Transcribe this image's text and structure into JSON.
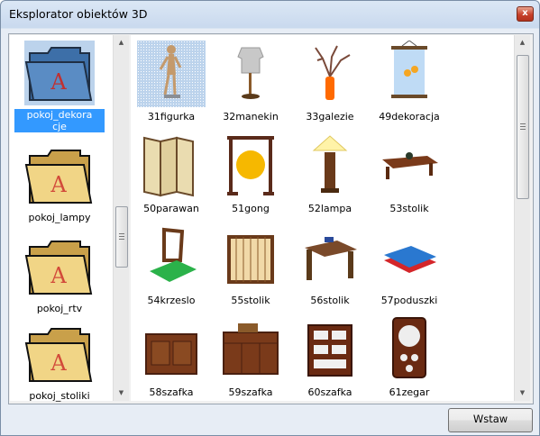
{
  "window": {
    "title": "Eksplorator obiektów 3D",
    "close_symbol": "x"
  },
  "folders": [
    {
      "label": "pokoj_dekoracje",
      "line1": "pokoj_dekora",
      "line2": "cje",
      "selected": true
    },
    {
      "label": "pokoj_lampy"
    },
    {
      "label": "pokoj_rtv"
    },
    {
      "label": "pokoj_stoliki"
    }
  ],
  "objects": [
    {
      "label": "31figurka",
      "selected": true
    },
    {
      "label": "32manekin"
    },
    {
      "label": "33galezie"
    },
    {
      "label": "49dekoracja"
    },
    {
      "label": "50parawan"
    },
    {
      "label": "51gong"
    },
    {
      "label": "52lampa"
    },
    {
      "label": "53stolik"
    },
    {
      "label": "54krzeslo"
    },
    {
      "label": "55stolik"
    },
    {
      "label": "56stolik"
    },
    {
      "label": "57poduszki"
    },
    {
      "label": "58szafka"
    },
    {
      "label": "59szafka"
    },
    {
      "label": "60szafka"
    },
    {
      "label": "61zegar"
    }
  ],
  "footer": {
    "insert_label": "Wstaw"
  }
}
